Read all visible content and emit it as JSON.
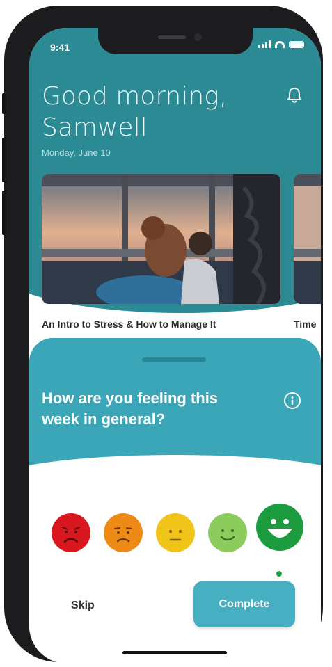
{
  "status_bar": {
    "time": "9:41"
  },
  "header": {
    "greeting_line1": "Good morning,",
    "greeting_line2": "Samwell",
    "date": "Monday, June 10"
  },
  "cards": [
    {
      "title": "An Intro to Stress & How to Manage It"
    },
    {
      "title": "Time"
    }
  ],
  "sheet": {
    "question_line1": "How are you feeling this",
    "question_line2": "week in general?"
  },
  "moods": [
    {
      "name": "very-sad",
      "color": "#d9171f"
    },
    {
      "name": "sad",
      "color": "#ee8a16"
    },
    {
      "name": "neutral",
      "color": "#f0c418"
    },
    {
      "name": "happy",
      "color": "#8ccc5c"
    },
    {
      "name": "very-happy",
      "color": "#1c9b3f",
      "selected": true
    }
  ],
  "actions": {
    "skip_label": "Skip",
    "complete_label": "Complete"
  },
  "colors": {
    "header_teal": "#2b8a93",
    "sheet_teal": "#3aa6b8",
    "button_teal": "#46afc2"
  }
}
